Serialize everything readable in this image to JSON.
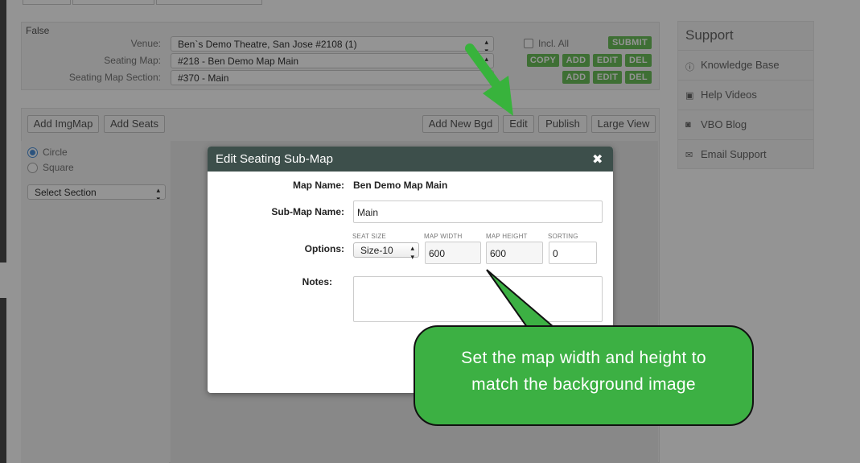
{
  "venue_panel": {
    "flag": "False",
    "venue_label": "Venue:",
    "venue_value": "Ben`s Demo Theatre, San Jose #2108 (1)",
    "incl_all": "Incl. All",
    "submit": "SUBMIT",
    "seating_map_label": "Seating Map:",
    "seating_map_value": "#218 - Ben Demo Map Main",
    "section_label": "Seating Map Section:",
    "section_value": "#370 - Main",
    "copy": "COPY",
    "add": "ADD",
    "edit": "EDIT",
    "del": "DEL"
  },
  "toolbar": {
    "add_imgmap": "Add ImgMap",
    "add_seats": "Add Seats",
    "add_new_bgd": "Add New Bgd",
    "edit": "Edit",
    "publish": "Publish",
    "large_view": "Large View"
  },
  "side": {
    "circle": "Circle",
    "square": "Square",
    "select_section": "Select Section"
  },
  "support": {
    "title": "Support",
    "items": [
      {
        "label": "Knowledge Base",
        "icon": "info-icon"
      },
      {
        "label": "Help Videos",
        "icon": "camera-icon"
      },
      {
        "label": "VBO Blog",
        "icon": "rss-icon"
      },
      {
        "label": "Email Support",
        "icon": "envelope-icon"
      }
    ]
  },
  "modal": {
    "title": "Edit Seating Sub-Map",
    "map_name_label": "Map Name:",
    "map_name_value": "Ben Demo Map Main",
    "sub_map_label": "Sub-Map Name:",
    "sub_map_value": "Main",
    "options_label": "Options:",
    "seat_size_label": "SEAT SIZE",
    "seat_size_value": "Size-10",
    "map_width_label": "MAP WIDTH",
    "map_width_value": "600",
    "map_height_label": "MAP HEIGHT",
    "map_height_value": "600",
    "sorting_label": "SORTING",
    "sorting_value": "0",
    "notes_label": "Notes:"
  },
  "callout": {
    "line1": "Set the map width and height to",
    "line2": "match the background image"
  },
  "colors": {
    "green_button": "#6cc05a",
    "callout_green": "#3cb043",
    "arrow_green": "#38b33c",
    "modal_header": "#3d4f4b"
  }
}
